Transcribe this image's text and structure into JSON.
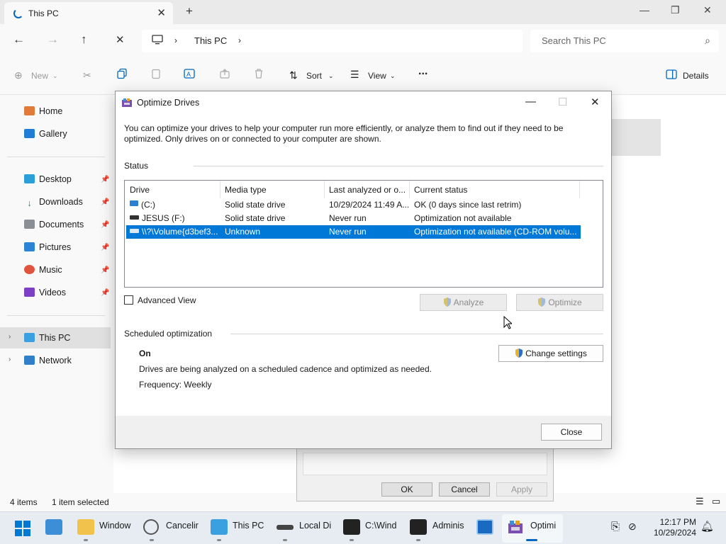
{
  "explorer": {
    "tab_title": "This PC",
    "address": {
      "root_icon": "monitor-icon",
      "location": "This PC"
    },
    "search_placeholder": "Search This PC",
    "commands": {
      "new": "New",
      "sort": "Sort",
      "view": "View",
      "more": "...",
      "details": "Details"
    },
    "nav": [
      {
        "label": "Home",
        "icon": "home-icon"
      },
      {
        "label": "Gallery",
        "icon": "gallery-icon"
      },
      {
        "label": "Desktop",
        "icon": "desktop-icon"
      },
      {
        "label": "Downloads",
        "icon": "downloads-icon"
      },
      {
        "label": "Documents",
        "icon": "documents-icon"
      },
      {
        "label": "Pictures",
        "icon": "pictures-icon"
      },
      {
        "label": "Music",
        "icon": "music-icon"
      },
      {
        "label": "Videos",
        "icon": "videos-icon"
      },
      {
        "label": "This PC",
        "icon": "monitor-icon"
      },
      {
        "label": "Network",
        "icon": "network-icon"
      }
    ],
    "status": {
      "items": "4 items",
      "selected": "1 item selected"
    }
  },
  "bg_dialog": {
    "ok": "OK",
    "cancel": "Cancel",
    "apply": "Apply"
  },
  "dialog": {
    "title": "Optimize Drives",
    "description": "You can optimize your drives to help your computer run more efficiently, or analyze them to find out if they need to be optimized. Only drives on or connected to your computer are shown.",
    "status_label": "Status",
    "columns": [
      "Drive",
      "Media type",
      "Last analyzed or o...",
      "Current status"
    ],
    "drives": [
      {
        "drive": "(C:)",
        "media": "Solid state drive",
        "last": "10/29/2024 11:49 A...",
        "status": "OK (0 days since last retrim)"
      },
      {
        "drive": "JESUS (F:)",
        "media": "Solid state drive",
        "last": "Never run",
        "status": "Optimization not available"
      },
      {
        "drive": "\\\\?\\Volume{d3bef3...",
        "media": "Unknown",
        "last": "Never run",
        "status": "Optimization not available (CD-ROM volu..."
      }
    ],
    "advanced_view": "Advanced View",
    "analyze": "Analyze",
    "optimize": "Optimize",
    "scheduled_label": "Scheduled optimization",
    "sched_state": "On",
    "sched_desc": "Drives are being analyzed on a scheduled cadence and optimized as needed.",
    "frequency": "Frequency: Weekly",
    "change_settings": "Change settings",
    "close": "Close"
  },
  "taskbar": {
    "apps": [
      {
        "label": "Window",
        "icon": "folder-icon"
      },
      {
        "label": "Cancelir",
        "icon": "clock-icon"
      },
      {
        "label": "This PC",
        "icon": "monitor-icon"
      },
      {
        "label": "Local Di",
        "icon": "drive-icon"
      },
      {
        "label": "C:\\Wind",
        "icon": "terminal-icon"
      },
      {
        "label": "Adminis",
        "icon": "terminal-icon"
      },
      {
        "label": "Optimi",
        "icon": "defrag-icon"
      }
    ],
    "time": "12:17 PM",
    "date": "10/29/2024"
  }
}
